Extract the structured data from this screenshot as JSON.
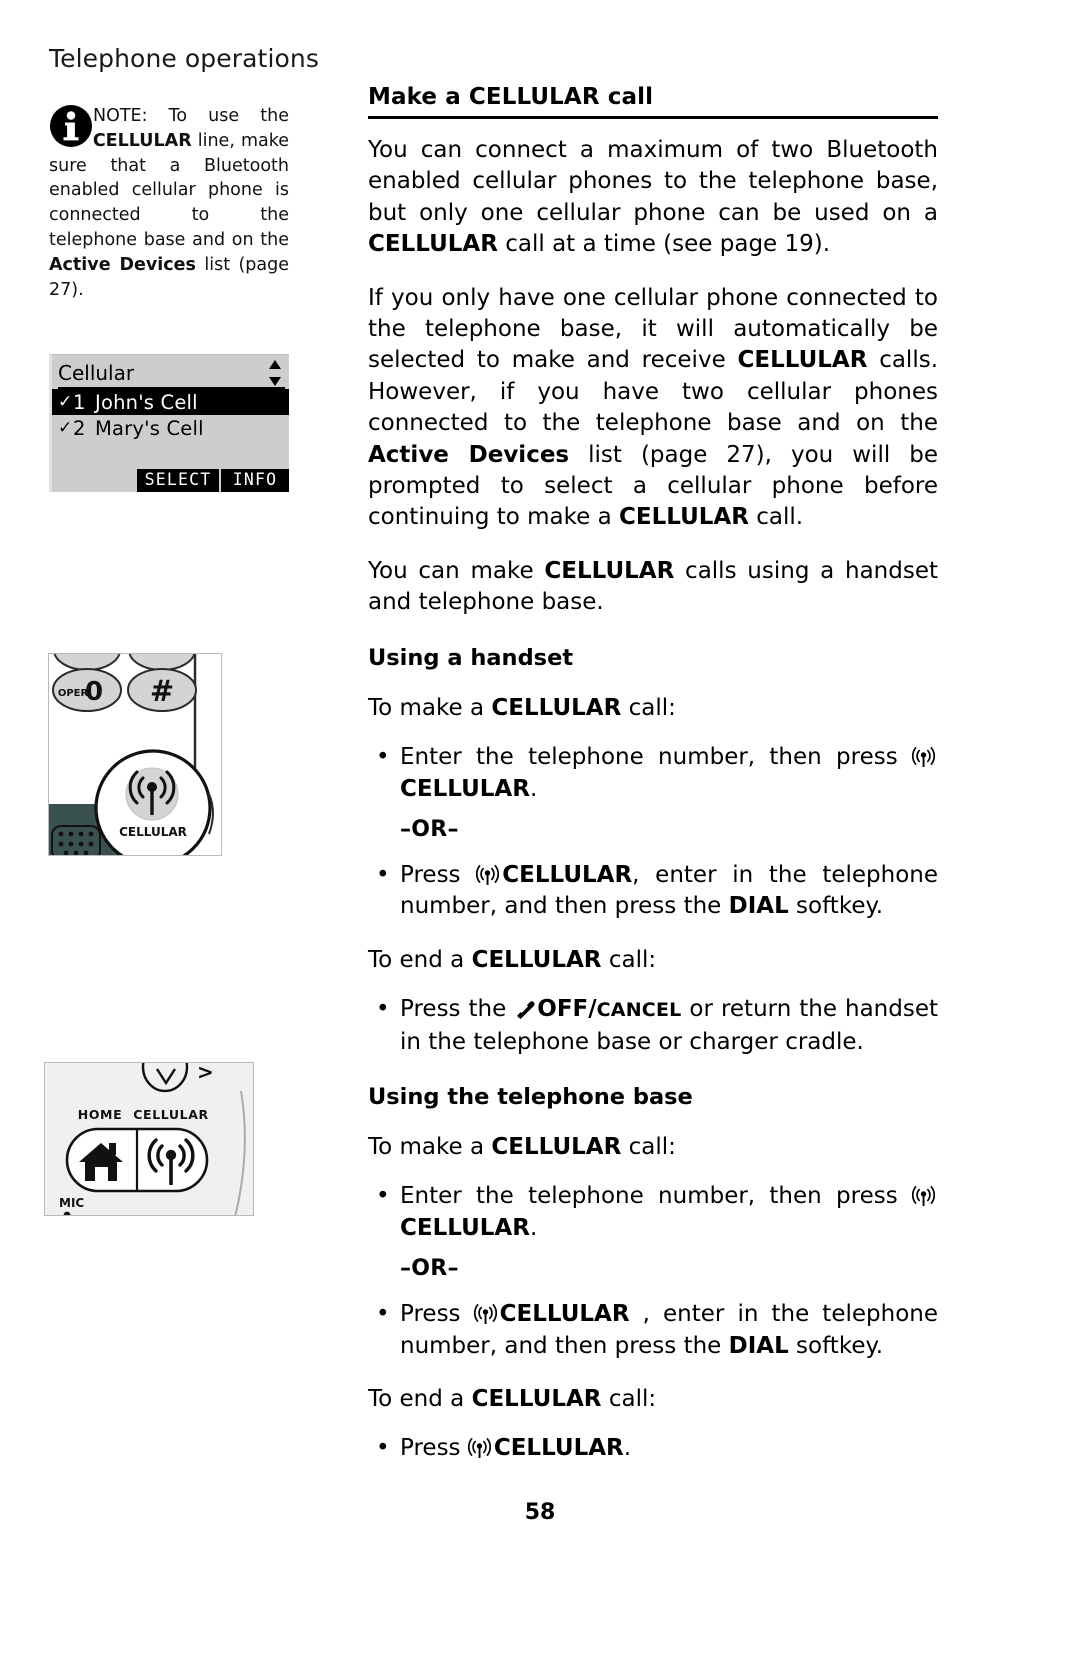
{
  "page": {
    "running_head": "Telephone operations",
    "folio": "58"
  },
  "note": {
    "icon": "info-icon",
    "label": "NOTE:",
    "text_parts": [
      {
        "t": "NOTE: ",
        "b": false
      },
      {
        "t": "To use the ",
        "b": false
      },
      {
        "t": "CELLULAR",
        "b": true
      },
      {
        "t": " line, make sure that a Bluetooth enabled cellular phone is connected to the telephone base and on the ",
        "b": false
      },
      {
        "t": "Active Devices",
        "b": true
      },
      {
        "t": " list (page 27).",
        "b": false
      }
    ]
  },
  "lcd": {
    "title": "Cellular",
    "scroll_icon": "up-down-arrow-icon",
    "rows": [
      {
        "check": "✓",
        "num": "1",
        "name": "John's Cell",
        "selected": true
      },
      {
        "check": "✓",
        "num": "2",
        "name": "Mary's Cell",
        "selected": false
      }
    ],
    "softkeys": [
      {
        "label": "SELECT"
      },
      {
        "label": "INFO"
      }
    ]
  },
  "figure_handset": {
    "keys": [
      {
        "label_small": "OPER",
        "label": "0"
      },
      {
        "label": "#"
      }
    ],
    "cellular_label": "CELLULAR",
    "icon": "cellular-antenna-icon"
  },
  "figure_base": {
    "labels": [
      "HOME",
      "CELLULAR"
    ],
    "mic_label": "MIC",
    "icons": [
      "home-icon",
      "cellular-antenna-icon"
    ]
  },
  "main": {
    "heading": "Make a CELLULAR call",
    "paragraphs": [
      [
        {
          "t": "You can connect a maximum of two Bluetooth enabled cellular phones to the telephone base, but only one cellular phone can be used on a ",
          "b": false
        },
        {
          "t": "CELLULAR",
          "b": true
        },
        {
          "t": " call at a time (see page 19).",
          "b": false
        }
      ],
      [
        {
          "t": "If you only have one cellular phone connected to the telephone base, it will automatically be selected to make and receive ",
          "b": false
        },
        {
          "t": "CELLULAR",
          "b": true
        },
        {
          "t": " calls. However, if you have two cellular phones connected to the telephone base and on the ",
          "b": false
        },
        {
          "t": "Active Devices",
          "b": true
        },
        {
          "t": " list (page 27), you will be prompted to select a cellular phone before continuing to make a ",
          "b": false
        },
        {
          "t": "CELLULAR",
          "b": true
        },
        {
          "t": " call.",
          "b": false
        }
      ],
      [
        {
          "t": "You can make ",
          "b": false
        },
        {
          "t": "CELLULAR",
          "b": true
        },
        {
          "t": " calls using a handset and telephone base.",
          "b": false
        }
      ]
    ],
    "section_handset": {
      "heading": "Using a handset",
      "cue_make": "To make a CELLULAR call:",
      "bullet1": [
        {
          "t": "Enter the telephone number, then press ",
          "b": false
        },
        {
          "t": "◉",
          "icon": "cellular-antenna-icon"
        },
        {
          "t": "CELLULAR",
          "b": true
        },
        {
          "t": ".",
          "b": false
        }
      ],
      "or": "–OR–",
      "bullet2": [
        {
          "t": "Press ",
          "b": false
        },
        {
          "t": "◉",
          "icon": "cellular-antenna-icon"
        },
        {
          "t": "CELLULAR",
          "b": true
        },
        {
          "t": ", enter in the telephone number, and then press the ",
          "b": false
        },
        {
          "t": "DIAL",
          "b": true
        },
        {
          "t": " softkey.",
          "b": false
        }
      ],
      "cue_end": "To end a CELLULAR call:",
      "bullet3": [
        {
          "t": "Press the ",
          "b": false
        },
        {
          "t": "☎",
          "icon": "off-cancel-handset-icon"
        },
        {
          "t": "OFF/",
          "b": true
        },
        {
          "t": "CANCEL",
          "sc": true
        },
        {
          "t": " or return the handset in the telephone base or charger cradle.",
          "b": false
        }
      ]
    },
    "section_base": {
      "heading": "Using the telephone base",
      "cue_make": "To make a CELLULAR call:",
      "bullet1": [
        {
          "t": "Enter the telephone number, then press ",
          "b": false
        },
        {
          "t": "◉",
          "icon": "cellular-antenna-icon"
        },
        {
          "t": "CELLULAR",
          "b": true
        },
        {
          "t": ".",
          "b": false
        }
      ],
      "or": "–OR–",
      "bullet2": [
        {
          "t": "Press ",
          "b": false
        },
        {
          "t": "◉",
          "icon": "cellular-antenna-icon"
        },
        {
          "t": "CELLULAR",
          "b": true
        },
        {
          "t": " , enter in the telephone number, and then press the ",
          "b": false
        },
        {
          "t": "DIAL",
          "b": true
        },
        {
          "t": " softkey.",
          "b": false
        }
      ],
      "cue_end": "To end a CELLULAR call:",
      "bullet3": [
        {
          "t": "Press ",
          "b": false
        },
        {
          "t": "◉",
          "icon": "cellular-antenna-icon"
        },
        {
          "t": "CELLULAR",
          "b": true
        },
        {
          "t": ".",
          "b": false
        }
      ]
    }
  },
  "colors": {
    "lcd_background": "#cdcdcd",
    "lcd_highlight": "#000000",
    "text": "#000000",
    "figure_border": "#b9b9b9"
  }
}
